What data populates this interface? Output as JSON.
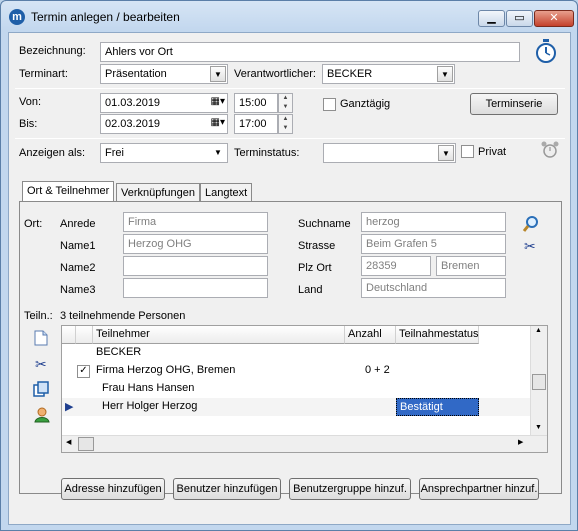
{
  "window": {
    "title": "Termin anlegen / bearbeiten",
    "minimize": "▁",
    "maximize": "▭",
    "close": "✕"
  },
  "form": {
    "bezeichnung_label": "Bezeichnung:",
    "bezeichnung_value": "Ahlers vor Ort",
    "terminart_label": "Terminart:",
    "terminart_value": "Präsentation",
    "verantwortlicher_label": "Verantwortlicher:",
    "verantwortlicher_value": "BECKER",
    "von_label": "Von:",
    "von_date": "01.03.2019",
    "von_time": "15:00",
    "bis_label": "Bis:",
    "bis_date": "02.03.2019",
    "bis_time": "17:00",
    "ganztaegig_label": "Ganztägig",
    "terminserie_button": "Terminserie",
    "anzeigen_label": "Anzeigen als:",
    "anzeigen_value": "Frei",
    "terminstatus_label": "Terminstatus:",
    "terminstatus_value": "",
    "privat_label": "Privat"
  },
  "tabs": [
    {
      "label": "Ort & Teilnehmer",
      "active": true
    },
    {
      "label": "Verknüpfungen",
      "active": false
    },
    {
      "label": "Langtext",
      "active": false
    }
  ],
  "ort": {
    "section_label": "Ort:",
    "anrede_label": "Anrede",
    "anrede_value": "Firma",
    "name1_label": "Name1",
    "name1_value": "Herzog OHG",
    "name2_label": "Name2",
    "name2_value": "",
    "name3_label": "Name3",
    "name3_value": "",
    "suchname_label": "Suchname",
    "suchname_value": "herzog",
    "strasse_label": "Strasse",
    "strasse_value": "Beim Grafen 5",
    "plzort_label": "Plz Ort",
    "plz_value": "28359",
    "ort_value": "Bremen",
    "land_label": "Land",
    "land_value": "Deutschland"
  },
  "teilnehmer": {
    "section_label": "Teiln.:",
    "count_text": "3 teilnehmende Personen",
    "columns": [
      "Teilnehmer",
      "Anzahl",
      "Teilnahmestatus"
    ],
    "rows": [
      {
        "name": "BECKER",
        "anzahl": "",
        "status": "",
        "checkbox": false,
        "indent": false
      },
      {
        "name": "Firma Herzog OHG, Bremen",
        "anzahl": "0 + 2",
        "status": "",
        "checkbox": true,
        "indent": false
      },
      {
        "name": "Frau Hans Hansen",
        "anzahl": "",
        "status": "",
        "checkbox": false,
        "indent": true
      },
      {
        "name": "Herr Holger Herzog",
        "anzahl": "",
        "status": "Bestätigt",
        "checkbox": false,
        "indent": true
      }
    ]
  },
  "buttons": {
    "adresse": "Adresse hinzufügen",
    "benutzer": "Benutzer hinzufügen",
    "benutzergruppe": "Benutzergruppe hinzuf.",
    "ansprechpartner": "Ansprechpartner hinzuf."
  },
  "icons": [
    "app-icon",
    "stopwatch-icon",
    "alarm-clock-icon",
    "search-icon",
    "scissors-icon",
    "new-document-icon",
    "copy-icon",
    "person-icon",
    "calendar-icon"
  ],
  "colors": {
    "selection": "#3169c6",
    "titlebar": "#c2d7ee"
  }
}
